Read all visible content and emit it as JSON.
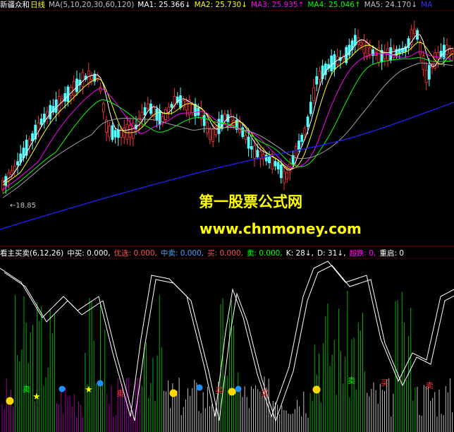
{
  "top_header": {
    "stock": "新疆众和",
    "period": "日线",
    "ma_def": "MA(5,10,20,30,60,120)",
    "ma1": "MA1: 25.366↓",
    "ma2": "MA2: 25.730↓",
    "ma3": "MA3: 25.935↑",
    "ma4": "MA4: 25.046↑",
    "ma5": "MA5: 24.170↓",
    "ma6": "MA"
  },
  "bottom_header": {
    "name": "看主买卖(6,12,26)",
    "zhongmai": "中买: 0.000,",
    "youxuan": "优选: 0.000,",
    "zhongmai2": "中卖: 0.000,",
    "mai": "买: 0.000,",
    "maic": "卖: 0.000,",
    "k": "K: 28↓,",
    "d": "D: 31↓,",
    "chaodie": "超跌: 0,",
    "chongqi": "重启: 0"
  },
  "watermark": {
    "line1": "第一股票公式网",
    "line2": "www.chnmoney.com"
  },
  "low_label": "←18.85",
  "signals": {
    "sell": "卖",
    "buy": "买"
  },
  "colors": {
    "up": "#ff3333",
    "down": "#54ffff",
    "ma1": "#ffffff",
    "ma2": "#ffff00",
    "ma3": "#ff00ff",
    "ma4": "#00ff00",
    "ma5": "#a0a0a0",
    "ma120": "#2020ff",
    "k": "#ffffff",
    "d": "#ffffff",
    "green_bar": "#00c000",
    "magenta_bar": "#d000d0"
  }
}
